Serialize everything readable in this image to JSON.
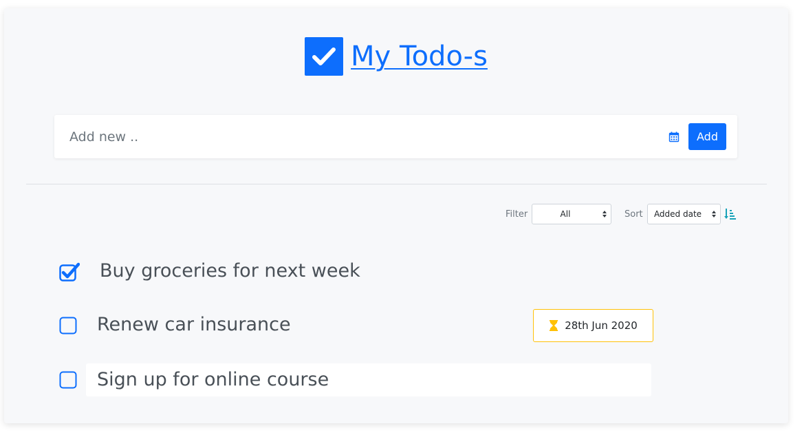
{
  "app": {
    "title": "My Todo-s"
  },
  "add_bar": {
    "placeholder": "Add new ..",
    "button_label": "Add"
  },
  "controls": {
    "filter_label": "Filter",
    "filter_value": "All",
    "sort_label": "Sort",
    "sort_value": "Added date"
  },
  "todos": [
    {
      "text": "Buy groceries for next week",
      "completed": true
    },
    {
      "text": "Renew car insurance",
      "completed": false,
      "due": "28th Jun 2020"
    },
    {
      "text": "Sign up for online course",
      "completed": false
    }
  ],
  "colors": {
    "primary": "#0d6efd",
    "warning": "#ffc107",
    "sort_icon": "#17a2b8"
  },
  "icons": [
    "check-square-icon",
    "calendar-icon",
    "sort-amount-icon",
    "hourglass-icon"
  ]
}
